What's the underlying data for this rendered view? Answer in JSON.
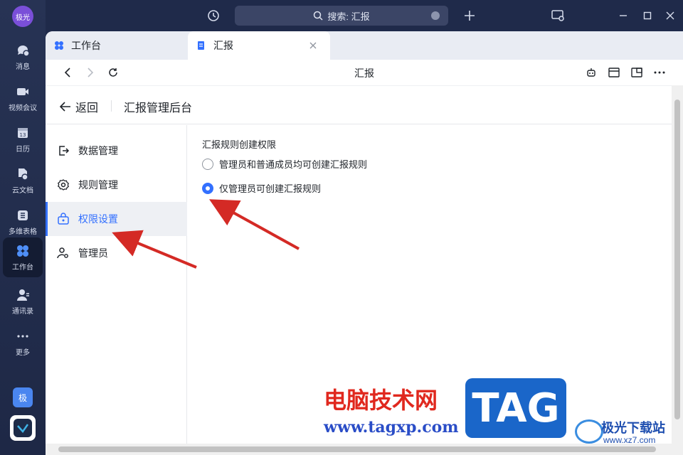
{
  "rail": {
    "avatar": "极光",
    "items": [
      {
        "label": "消息",
        "icon": "chat-bubble-icon"
      },
      {
        "label": "视频会议",
        "icon": "video-camera-icon"
      },
      {
        "label": "日历",
        "icon": "calendar-icon",
        "day": "13"
      },
      {
        "label": "云文档",
        "icon": "cloud-doc-icon"
      },
      {
        "label": "多维表格",
        "icon": "table-icon"
      },
      {
        "label": "工作台",
        "icon": "workspace-grid-icon",
        "active": true
      },
      {
        "label": "通讯录",
        "icon": "contacts-icon"
      },
      {
        "label": "更多",
        "icon": "more-dots-icon"
      }
    ],
    "badge": "极"
  },
  "titlebar": {
    "search_text": "搜索: 汇报"
  },
  "tabs": [
    {
      "label": "工作台",
      "icon": "workspace-grid-icon"
    },
    {
      "label": "汇报",
      "icon": "report-doc-icon",
      "active": true
    }
  ],
  "navbar": {
    "title": "汇报"
  },
  "header": {
    "back_label": "返回",
    "title": "汇报管理后台"
  },
  "menu": [
    {
      "label": "数据管理",
      "icon": "export-icon"
    },
    {
      "label": "规则管理",
      "icon": "gear-icon"
    },
    {
      "label": "权限设置",
      "icon": "lock-bag-icon",
      "active": true
    },
    {
      "label": "管理员",
      "icon": "admin-user-icon"
    }
  ],
  "panel": {
    "title": "汇报规则创建权限",
    "options": [
      {
        "label": "管理员和普通成员均可创建汇报规则",
        "checked": false
      },
      {
        "label": "仅管理员可创建汇报规则",
        "checked": true
      }
    ]
  },
  "watermark": {
    "site_name": "电脑技术网",
    "url": "www.tagxp.com",
    "tag": "TAG",
    "logo_name": "极光下载站",
    "logo_url": "www.xz7.com"
  },
  "colors": {
    "accent": "#3370ff",
    "rail_bg": "#273354",
    "arrow": "#d42a25"
  }
}
